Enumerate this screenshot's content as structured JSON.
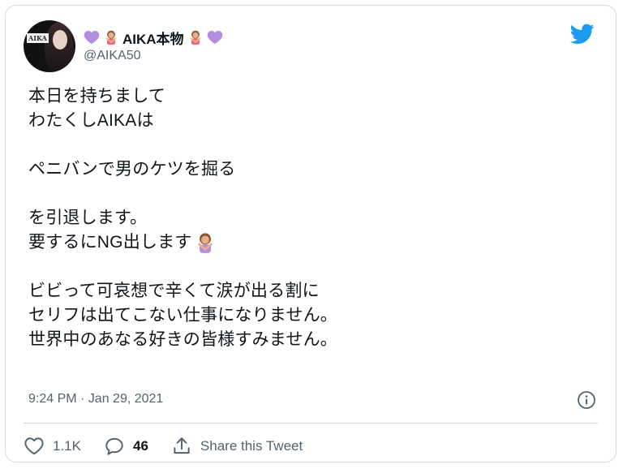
{
  "tweet": {
    "author": {
      "display_name": "AIKA本物",
      "handle": "@AIKA50",
      "avatar_text": "AIKA"
    },
    "lines": [
      "本日を持ちまして",
      "わたくしAIKAは",
      "",
      "ペニバンで男のケツを掘る",
      "",
      "を引退します。",
      "要するにNG出します",
      "",
      "ビビって可哀想で辛くて涙が出る割に",
      "セリフは出てこない仕事になりません。",
      "世界中のあなる好きの皆様すみません。"
    ],
    "timestamp": "9:24 PM · Jan 29, 2021",
    "likes": "1.1K",
    "replies": "46",
    "share_label": "Share this Tweet"
  },
  "colors": {
    "twitter_blue": "#1d9bf0",
    "heart_purple": "#b18ee0",
    "muted": "#536471"
  },
  "icons": {
    "logo": "twitter-bird-icon",
    "info": "info-icon",
    "like": "heart-outline-icon",
    "reply": "speech-bubble-icon",
    "share": "share-upload-icon"
  }
}
